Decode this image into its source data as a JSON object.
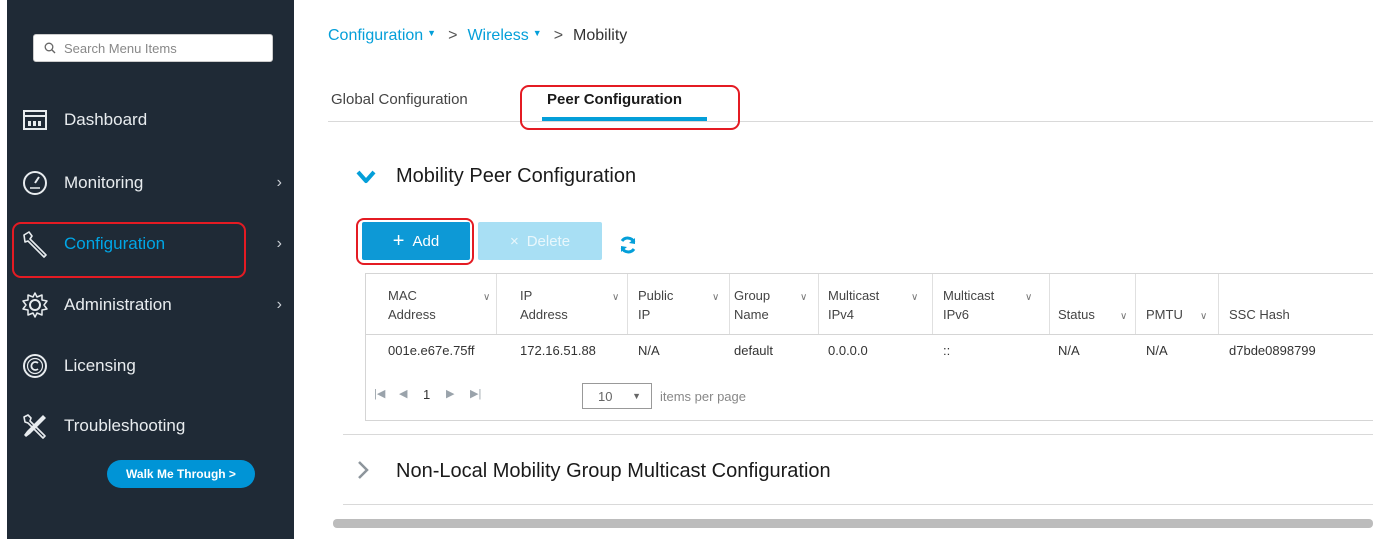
{
  "sidebar": {
    "search_placeholder": "Search Menu Items",
    "items": [
      {
        "label": "Dashboard",
        "icon": "dashboard-icon"
      },
      {
        "label": "Monitoring",
        "icon": "monitoring-icon"
      },
      {
        "label": "Configuration",
        "icon": "wrench-icon",
        "active": true
      },
      {
        "label": "Administration",
        "icon": "gear-icon"
      },
      {
        "label": "Licensing",
        "icon": "copyright-icon"
      },
      {
        "label": "Troubleshooting",
        "icon": "tools-icon"
      }
    ],
    "walk_me_through": "Walk Me Through >"
  },
  "breadcrumb": {
    "item1": "Configuration",
    "item2": "Wireless",
    "current": "Mobility",
    "separator": ">"
  },
  "tabs": [
    {
      "label": "Global Configuration"
    },
    {
      "label": "Peer Configuration",
      "active": true
    }
  ],
  "sections": {
    "peer": "Mobility Peer Configuration",
    "non_local": "Non-Local Mobility Group Multicast Configuration"
  },
  "toolbar": {
    "add_label": "Add",
    "delete_label": "Delete"
  },
  "table": {
    "columns": [
      {
        "line1": "MAC",
        "line2": "Address"
      },
      {
        "line1": "IP",
        "line2": "Address"
      },
      {
        "line1": "Public",
        "line2": "IP"
      },
      {
        "line1": "Group",
        "line2": "Name"
      },
      {
        "line1": "Multicast",
        "line2": "IPv4"
      },
      {
        "line1": "Multicast",
        "line2": "IPv6"
      },
      {
        "line1": "",
        "line2": "Status"
      },
      {
        "line1": "",
        "line2": "PMTU"
      },
      {
        "line1": "",
        "line2": "SSC Hash"
      }
    ],
    "rows": [
      [
        "001e.e67e.75ff",
        "172.16.51.88",
        "N/A",
        "default",
        "0.0.0.0",
        "::",
        "N/A",
        "N/A",
        "d7bde0898799"
      ]
    ]
  },
  "pager": {
    "page": "1",
    "per_page": "10",
    "per_page_label": "items per page"
  },
  "colors": {
    "accent": "#049fd9",
    "highlight": "#e41b23",
    "sidebar_bg": "#1f2a36"
  }
}
